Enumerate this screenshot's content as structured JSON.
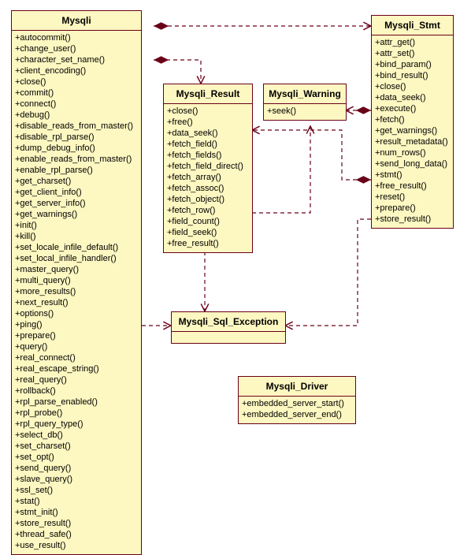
{
  "classes": {
    "mysqli": {
      "name": "Mysqli",
      "methods": [
        "+autocommit()",
        "+change_user()",
        "+character_set_name()",
        "+client_encoding()",
        "+close()",
        "+commit()",
        "+connect()",
        "+debug()",
        "+disable_reads_from_master()",
        "+disable_rpl_parse()",
        "+dump_debug_info()",
        "+enable_reads_from_master()",
        "+enable_rpl_parse()",
        "+get_charset()",
        "+get_client_info()",
        "+get_server_info()",
        "+get_warnings()",
        "+init()",
        "+kill()",
        "+set_locale_infile_default()",
        "+set_local_infile_handler()",
        "+master_query()",
        "+multi_query()",
        "+more_results()",
        "+next_result()",
        "+options()",
        "+ping()",
        "+prepare()",
        "+query()",
        "+real_connect()",
        "+real_escape_string()",
        "+real_query()",
        "+rollback()",
        "+rpl_parse_enabled()",
        "+rpl_probe()",
        "+rpl_query_type()",
        "+select_db()",
        "+set_charset()",
        "+set_opt()",
        "+send_query()",
        "+slave_query()",
        "+ssl_set()",
        "+stat()",
        "+stmt_init()",
        "+store_result()",
        "+thread_safe()",
        "+use_result()"
      ]
    },
    "mysqli_stmt": {
      "name": "Mysqli_Stmt",
      "methods": [
        "+attr_get()",
        "+attr_set()",
        "+bind_param()",
        "+bind_result()",
        "+close()",
        "+data_seek()",
        "+execute()",
        "+fetch()",
        "+get_warnings()",
        "+result_metadata()",
        "+num_rows()",
        "+send_long_data()",
        "+stmt()",
        "+free_result()",
        "+reset()",
        "+prepare()",
        "+store_result()"
      ]
    },
    "mysqli_result": {
      "name": "Mysqli_Result",
      "methods": [
        "+close()",
        "+free()",
        "+data_seek()",
        "+fetch_field()",
        "+fetch_fields()",
        "+fetch_field_direct()",
        "+fetch_array()",
        "+fetch_assoc()",
        "+fetch_object()",
        "+fetch_row()",
        "+field_count()",
        "+field_seek()",
        "+free_result()"
      ]
    },
    "mysqli_warning": {
      "name": "Mysqli_Warning",
      "methods": [
        "+seek()"
      ]
    },
    "mysqli_sql_exception": {
      "name": "Mysqli_Sql_Exception",
      "methods": []
    },
    "mysqli_driver": {
      "name": "Mysqli_Driver",
      "methods": [
        "+embedded_server_start()",
        "+embedded_server_end()"
      ]
    }
  }
}
